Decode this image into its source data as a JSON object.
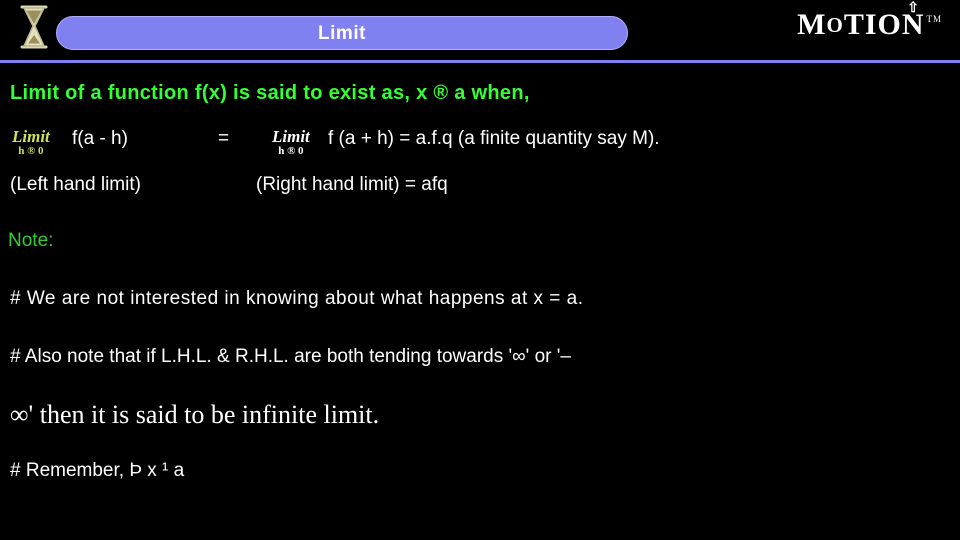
{
  "header": {
    "hourglass_icon": "hourglass-icon",
    "title": "Limit",
    "brand_m": "M",
    "brand_o": "O",
    "brand_rest": "TION",
    "brand_tail": "tion",
    "trademark": "TM",
    "arrow_icon": "up-arrow-icon"
  },
  "body": {
    "statement": "Limit of a function f(x) is said to exist as, x ® a when,",
    "equation": {
      "lhs_operator": {
        "lim": "Limit",
        "sub": "h ® 0"
      },
      "lhs_function": "f(a - h)",
      "equals": "=",
      "rhs_operator": {
        "lim": "Limit",
        "sub": "h ® 0"
      },
      "rhs_function": "f (a + h) =  a.f.q (a finite quantity say M)."
    },
    "labels": {
      "left": "(Left hand limit)",
      "right": "(Right hand limit) = afq"
    },
    "note_label": "Note:",
    "bullets": [
      "# We are not interested in knowing about what happens at x = a.",
      "#  Also note that if L.H.L.  &  R.H.L.  are  both  tending  towards  '∞'  or  '–",
      "∞'  then it is said to be infinite limit.",
      "# Remember,  Þ x ¹ a"
    ]
  },
  "colors": {
    "background": "#000000",
    "accent": "#8080f0",
    "statement": "#33ff33",
    "note": "#33cc33",
    "text": "#ffffff",
    "limit_glyph": "#cfe05a"
  }
}
